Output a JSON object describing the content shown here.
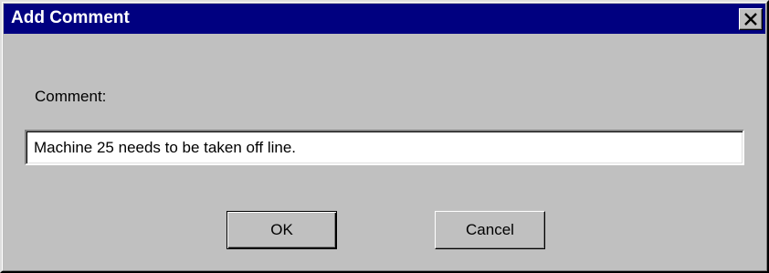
{
  "window": {
    "title": "Add Comment",
    "close_icon": "close-icon",
    "title_bar_color": "#000080",
    "face_color": "#c0c0c0"
  },
  "form": {
    "comment_label": "Comment:",
    "comment_value": "Machine 25 needs to be taken off line."
  },
  "buttons": {
    "ok_label": "OK",
    "cancel_label": "Cancel"
  }
}
